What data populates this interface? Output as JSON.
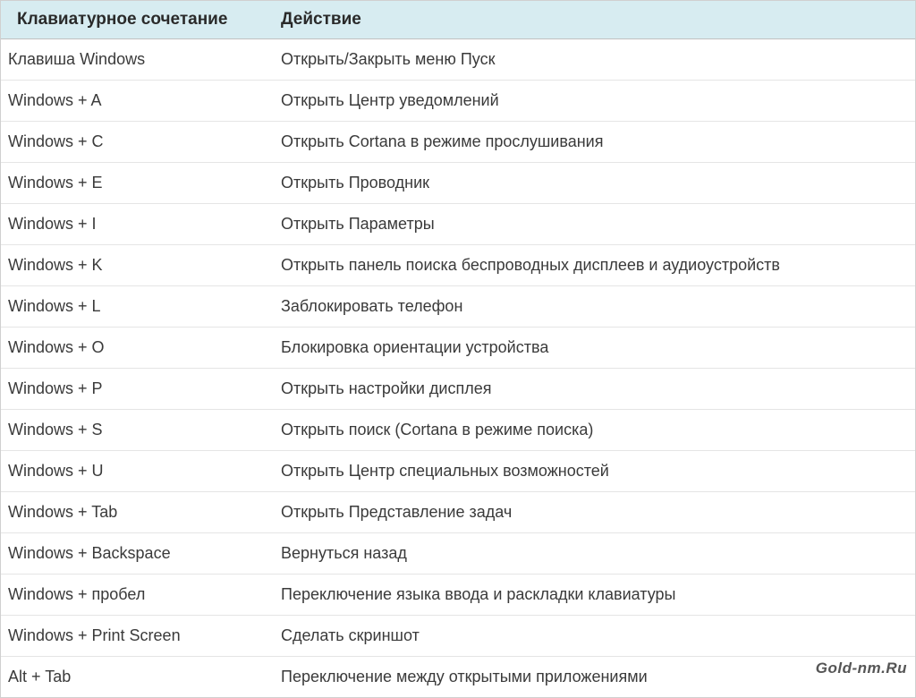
{
  "table": {
    "headers": {
      "shortcut": "Клавиатурное сочетание",
      "action": "Действие"
    },
    "rows": [
      {
        "shortcut": "Клавиша Windows",
        "action": "Открыть/Закрыть меню Пуск"
      },
      {
        "shortcut": "Windows + A",
        "action": "Открыть Центр уведомлений"
      },
      {
        "shortcut": "Windows + C",
        "action": "Открыть Cortana в режиме прослушивания"
      },
      {
        "shortcut": "Windows + E",
        "action": "Открыть Проводник"
      },
      {
        "shortcut": "Windows + I",
        "action": "Открыть Параметры"
      },
      {
        "shortcut": "Windows + K",
        "action": "Открыть панель поиска беспроводных дисплеев и аудиоустройств"
      },
      {
        "shortcut": "Windows + L",
        "action": "Заблокировать телефон"
      },
      {
        "shortcut": "Windows + O",
        "action": "Блокировка ориентации устройства"
      },
      {
        "shortcut": "Windows + P",
        "action": "Открыть настройки дисплея"
      },
      {
        "shortcut": "Windows + S",
        "action": "Открыть поиск (Cortana в режиме поиска)"
      },
      {
        "shortcut": "Windows + U",
        "action": "Открыть Центр специальных возможностей"
      },
      {
        "shortcut": "Windows + Tab",
        "action": "Открыть Представление задач"
      },
      {
        "shortcut": "Windows + Backspace",
        "action": "Вернуться назад"
      },
      {
        "shortcut": "Windows + пробел",
        "action": "Переключение языка ввода и раскладки клавиатуры"
      },
      {
        "shortcut": "Windows + Print Screen",
        "action": "Сделать скриншот"
      },
      {
        "shortcut": "Alt + Tab",
        "action": "Переключение между открытыми приложениями"
      }
    ]
  },
  "watermark": "Gold-nm.Ru"
}
